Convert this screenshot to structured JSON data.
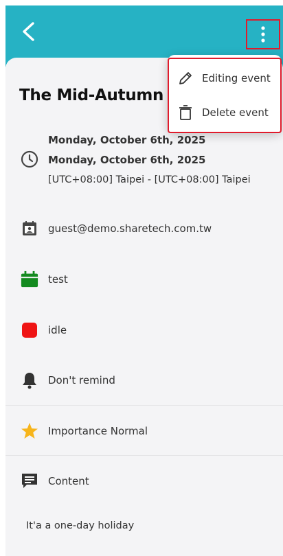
{
  "header": {
    "background": "#26b2c4"
  },
  "event": {
    "title": "The Mid-Autumn",
    "start_date": "Monday, October 6th, 2025",
    "end_date": "Monday, October 6th, 2025",
    "timezone": "[UTC+08:00] Taipei - [UTC+08:00] Taipei"
  },
  "details": {
    "email": "guest@demo.sharetech.com.tw",
    "calendar": "test",
    "status": "idle",
    "reminder": "Don't remind",
    "importance": "Importance Normal",
    "content_label": "Content",
    "note": "It'a a one-day holiday"
  },
  "menu": {
    "edit_label": "Editing event",
    "delete_label": "Delete event"
  },
  "colors": {
    "calendar_icon": "#138a1f",
    "status_icon": "#ef1414",
    "star_icon": "#f7b51c",
    "highlight": "#e01b2c"
  },
  "icons": [
    "back-arrow-icon",
    "more-vertical-icon",
    "clock-icon",
    "contact-card-icon",
    "calendar-icon",
    "status-square-icon",
    "bell-icon",
    "star-icon",
    "message-icon",
    "pencil-icon",
    "trash-icon"
  ]
}
